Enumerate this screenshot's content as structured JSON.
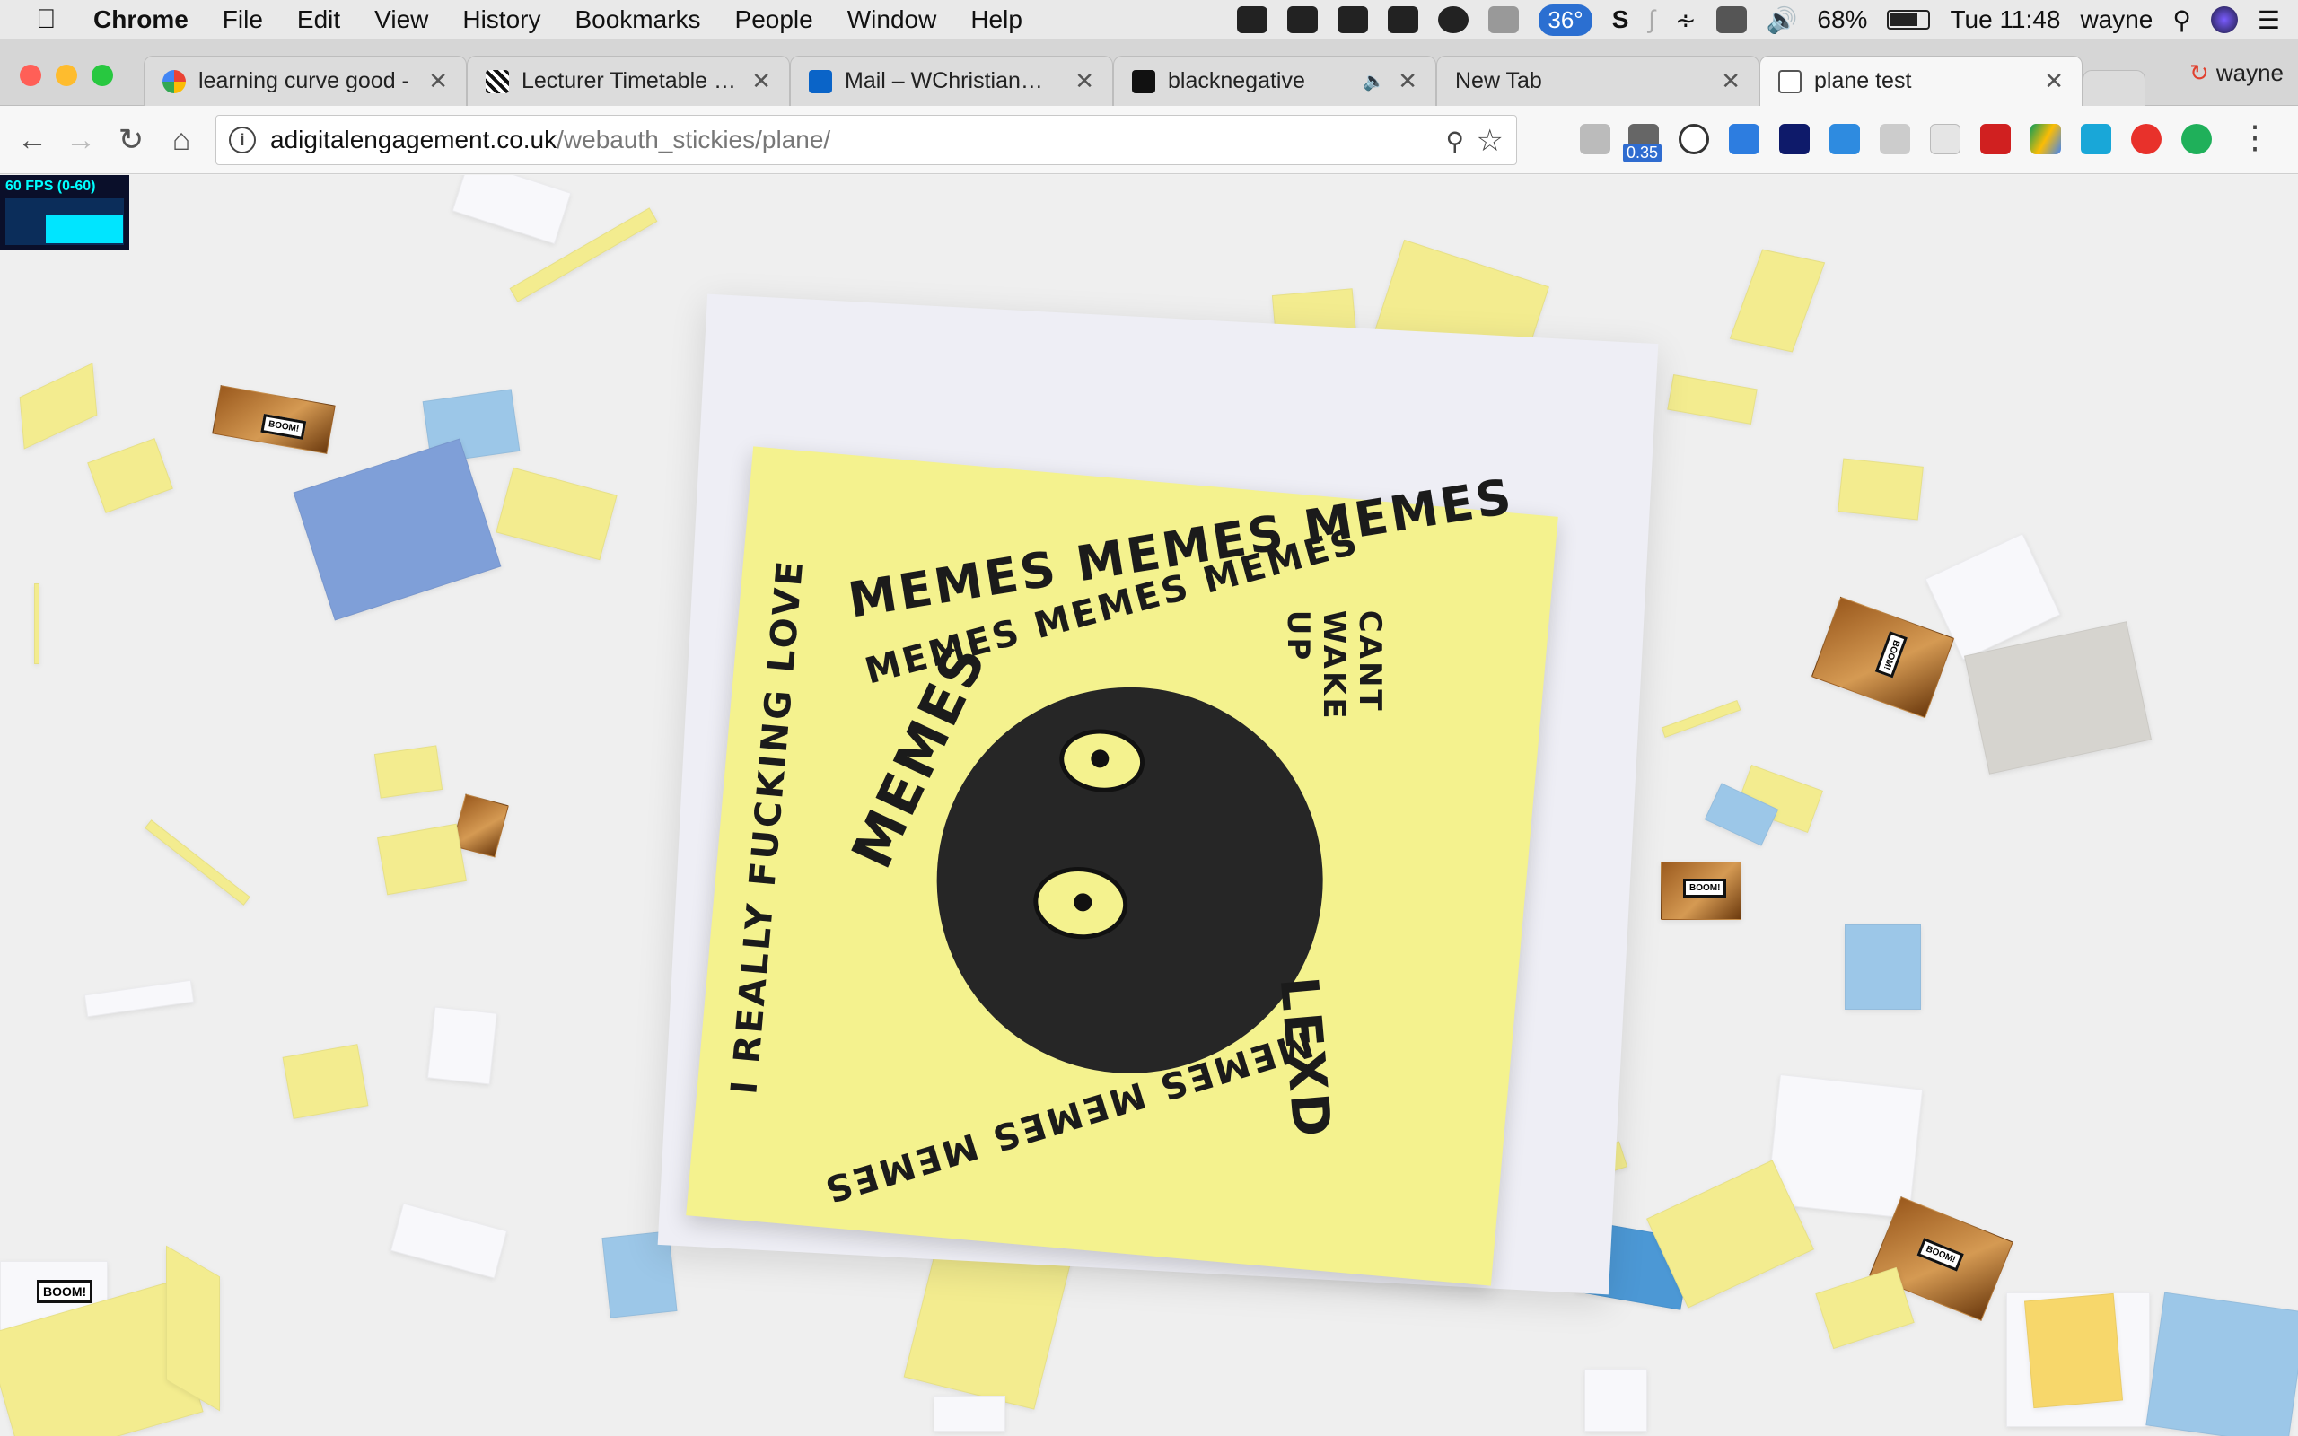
{
  "menubar": {
    "app": "Chrome",
    "items": [
      "File",
      "Edit",
      "View",
      "History",
      "Bookmarks",
      "People",
      "Window",
      "Help"
    ],
    "temperature": "36°",
    "battery": "68%",
    "clock": "Tue 11:48",
    "user": "wayne"
  },
  "tabs": [
    {
      "title": "learning curve good -",
      "favicon": "google-icon"
    },
    {
      "title": "Lecturer Timetable - U",
      "favicon": "qr-icon"
    },
    {
      "title": "Mail – WChristian@linc",
      "favicon": "outlook-icon"
    },
    {
      "title": "blacknegative",
      "favicon": "bn-icon",
      "audio": true
    },
    {
      "title": "New Tab",
      "favicon": ""
    },
    {
      "title": "plane test",
      "favicon": "page-icon",
      "active": true
    }
  ],
  "profile": {
    "name": "wayne"
  },
  "toolbar": {
    "url_host": "adigitalengagement.co.uk",
    "url_path": "/webauth_stickies/plane/",
    "extension_badge": "0.35"
  },
  "content": {
    "fps_label": "60 FPS (0-60)",
    "boom_label": "BOOM!",
    "note_words": {
      "left": "I REALLY FUCKING LOVE",
      "top1": "MEMES MEMES MEMES",
      "top2": "MEMES MEMES MEMES",
      "mid": "MEMES",
      "side": "CANT WAKE UP",
      "sig": "LEXD",
      "bottom": "MEMES MEMES MEMES"
    }
  },
  "colors": {
    "accent": "#2b6fd1",
    "sticky_yellow": "#f3ec8f",
    "sticky_blue": "#9cc7e8"
  }
}
